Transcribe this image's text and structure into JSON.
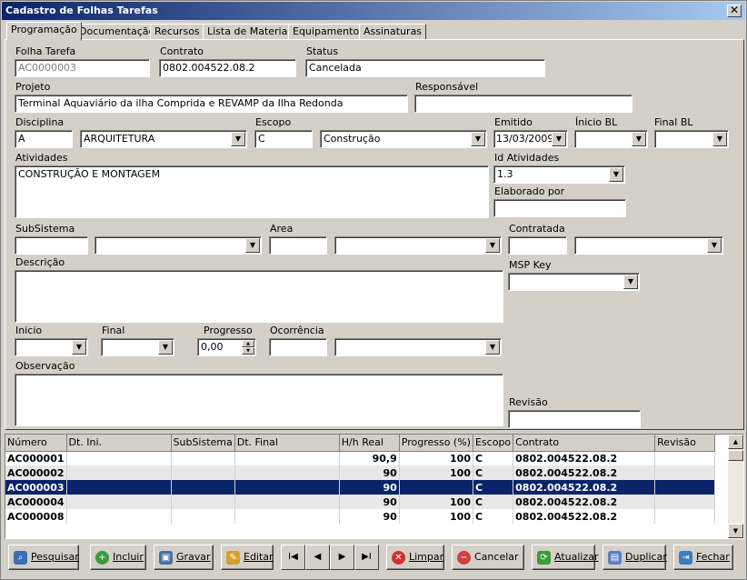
{
  "window": {
    "title": "Cadastro de Folhas Tarefas"
  },
  "tabs": [
    "Programação",
    "Documentação",
    "Recursos",
    "Lista de Materiais",
    "Equipamentos",
    "Assinaturas"
  ],
  "form": {
    "folha_tarefa": {
      "label": "Folha Tarefa",
      "value": "AC0000003"
    },
    "contrato": {
      "label": "Contrato",
      "value": "0802.004522.08.2"
    },
    "status": {
      "label": "Status",
      "value": "Cancelada"
    },
    "projeto": {
      "label": "Projeto",
      "value": "Terminal Aquaviário da ilha Comprida e REVAMP da Ilha Redonda"
    },
    "responsavel": {
      "label": "Responsável",
      "value": ""
    },
    "disciplina": {
      "label": "Disciplina",
      "code": "A",
      "name": "ARQUITETURA"
    },
    "escopo": {
      "label": "Escopo",
      "code": "C",
      "name": "Construção"
    },
    "emitido": {
      "label": "Emitido",
      "value": "13/03/2009"
    },
    "inicio_bl": {
      "label": "Ínicio BL",
      "value": ""
    },
    "final_bl": {
      "label": "Final BL",
      "value": ""
    },
    "atividades": {
      "label": "Atividades",
      "value": "CONSTRUÇÃO E MONTAGEM"
    },
    "id_atividades": {
      "label": "Id Atividades",
      "value": "1.3"
    },
    "elaborado_por": {
      "label": "Elaborado por",
      "value": ""
    },
    "subsistema": {
      "label": "SubSistema"
    },
    "area": {
      "label": "Area"
    },
    "contratada": {
      "label": "Contratada"
    },
    "descricao": {
      "label": "Descrição"
    },
    "msp_key": {
      "label": "MSP Key"
    },
    "inicio": {
      "label": "Inicio"
    },
    "final": {
      "label": "Final"
    },
    "progresso": {
      "label": "Progresso",
      "value": "0,00"
    },
    "ocorrencia": {
      "label": "Ocorrência"
    },
    "observacao": {
      "label": "Observação"
    },
    "revisao": {
      "label": "Revisão"
    }
  },
  "grid": {
    "columns": [
      "Número",
      "Dt. Ini.",
      "SubSistema",
      "Dt. Final",
      "H/h Real",
      "Progresso (%)",
      "Escopo",
      "Contrato",
      "Revisão"
    ],
    "rows": [
      [
        "AC000001",
        "",
        "",
        "",
        "90,9",
        "100",
        "C",
        "0802.004522.08.2",
        ""
      ],
      [
        "AC000002",
        "",
        "",
        "",
        "90",
        "100",
        "C",
        "0802.004522.08.2",
        ""
      ],
      [
        "AC000003",
        "",
        "",
        "",
        "90",
        "",
        "C",
        "0802.004522.08.2",
        ""
      ],
      [
        "AC000004",
        "",
        "",
        "",
        "90",
        "100",
        "C",
        "0802.004522.08.2",
        ""
      ],
      [
        "AC000008",
        "",
        "",
        "",
        "90",
        "100",
        "C",
        "0802.004522.08.2",
        ""
      ]
    ],
    "selected_row": 2
  },
  "toolbar": {
    "pesquisar": "Pesquisar",
    "incluir": "Incluir",
    "gravar": "Gravar",
    "editar": "Editar",
    "first": "I◀",
    "prev": "◀",
    "next": "▶",
    "last": "▶I",
    "limpar": "Limpar",
    "cancelar": "Cancelar",
    "atualizar": "Atualizar",
    "duplicar": "Duplicar",
    "fechar": "Fechar"
  },
  "colors": {
    "title_start": "#0a246a",
    "title_end": "#a6caf0",
    "selection": "#0a246a"
  }
}
